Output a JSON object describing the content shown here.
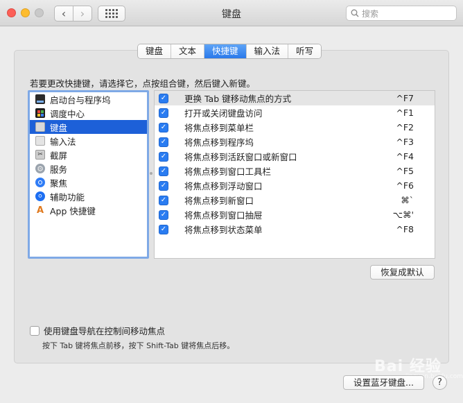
{
  "window": {
    "title": "键盘",
    "search_placeholder": "搜索"
  },
  "tabs": [
    {
      "label": "键盘",
      "active": false
    },
    {
      "label": "文本",
      "active": false
    },
    {
      "label": "快捷键",
      "active": true
    },
    {
      "label": "输入法",
      "active": false
    },
    {
      "label": "听写",
      "active": false
    }
  ],
  "instruction": "若要更改快捷键，请选择它，点按组合键，然后键入新键。",
  "categories": [
    {
      "label": "启动台与程序坞",
      "icon": "launchpad-dock-icon",
      "selected": false
    },
    {
      "label": "调度中心",
      "icon": "mission-control-icon",
      "selected": false
    },
    {
      "label": "键盘",
      "icon": "keyboard-icon",
      "selected": true
    },
    {
      "label": "输入法",
      "icon": "input-method-icon",
      "selected": false
    },
    {
      "label": "截屏",
      "icon": "screenshot-icon",
      "selected": false
    },
    {
      "label": "服务",
      "icon": "services-gear-icon",
      "selected": false
    },
    {
      "label": "聚焦",
      "icon": "spotlight-icon",
      "selected": false
    },
    {
      "label": "辅助功能",
      "icon": "accessibility-icon",
      "selected": false
    },
    {
      "label": "App 快捷键",
      "icon": "app-shortcuts-icon",
      "selected": false
    }
  ],
  "shortcuts": [
    {
      "label": "更换 Tab 键移动焦点的方式",
      "key": "^F7",
      "checked": true
    },
    {
      "label": "打开或关闭键盘访问",
      "key": "^F1",
      "checked": true
    },
    {
      "label": "将焦点移到菜单栏",
      "key": "^F2",
      "checked": true
    },
    {
      "label": "将焦点移到程序坞",
      "key": "^F3",
      "checked": true
    },
    {
      "label": "将焦点移到活跃窗口或新窗口",
      "key": "^F4",
      "checked": true
    },
    {
      "label": "将焦点移到窗口工具栏",
      "key": "^F5",
      "checked": true
    },
    {
      "label": "将焦点移到浮动窗口",
      "key": "^F6",
      "checked": true
    },
    {
      "label": "将焦点移到新窗口",
      "key": "⌘`",
      "checked": true
    },
    {
      "label": "将焦点移到窗口抽屉",
      "key": "⌥⌘'",
      "checked": true
    },
    {
      "label": "将焦点移到状态菜单",
      "key": "^F8",
      "checked": true
    }
  ],
  "restore_defaults": "恢复成默认",
  "keyboard_nav": {
    "label": "使用键盘导航在控制间移动焦点",
    "checked": false,
    "hint": "按下 Tab 键将焦点前移，按下 Shift-Tab 键将焦点后移。"
  },
  "bluetooth_button": "设置蓝牙键盘...",
  "help_button": "?",
  "watermark": {
    "main": "Bai 经验",
    "sub": "jingyan.baidu.com"
  }
}
